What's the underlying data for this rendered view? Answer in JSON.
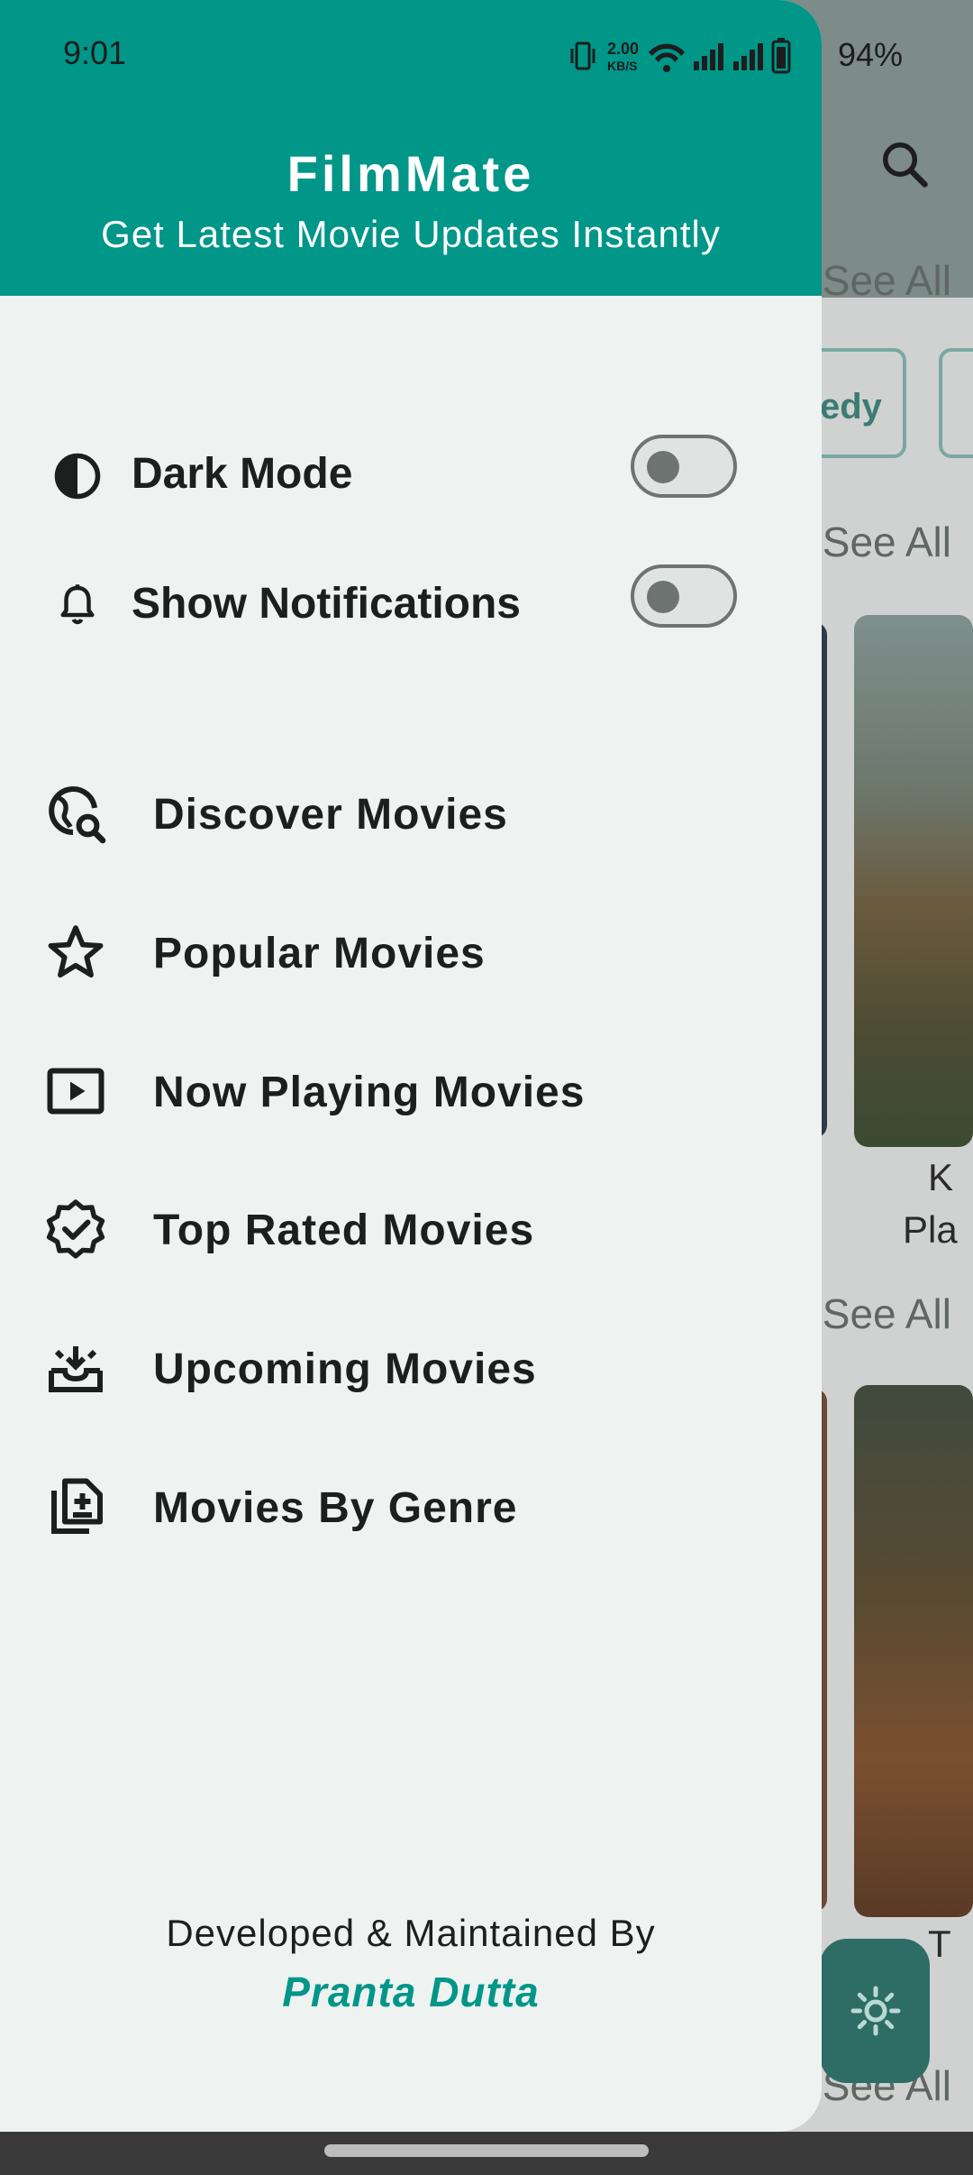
{
  "status_bar": {
    "time": "9:01",
    "net_speed_top": "2.00",
    "net_speed_unit": "KB/S",
    "battery": "94%"
  },
  "header": {
    "title": "FilmMate",
    "subtitle": "Get Latest Movie Updates Instantly"
  },
  "toggles": [
    {
      "label": "Dark Mode",
      "icon": "contrast-icon",
      "on": false
    },
    {
      "label": "Show Notifications",
      "icon": "bell-icon",
      "on": false
    }
  ],
  "menu": [
    {
      "label": "Discover Movies",
      "icon": "travel-explore-icon"
    },
    {
      "label": "Popular Movies",
      "icon": "star-icon"
    },
    {
      "label": "Now Playing Movies",
      "icon": "play-box-icon"
    },
    {
      "label": "Top Rated Movies",
      "icon": "verified-badge-icon"
    },
    {
      "label": "Upcoming Movies",
      "icon": "inbox-download-icon"
    },
    {
      "label": "Movies By Genre",
      "icon": "library-add-icon"
    }
  ],
  "footer": {
    "line1": "Developed & Maintained By",
    "author": "Pranta Dutta"
  },
  "background": {
    "see_all": "See All",
    "chip_partial": "edy",
    "poster_caption_1": "K",
    "poster_caption_2": "Pla",
    "poster_caption_3": "T"
  },
  "colors": {
    "accent": "#009688",
    "drawer_bg": "#eef3f1"
  }
}
